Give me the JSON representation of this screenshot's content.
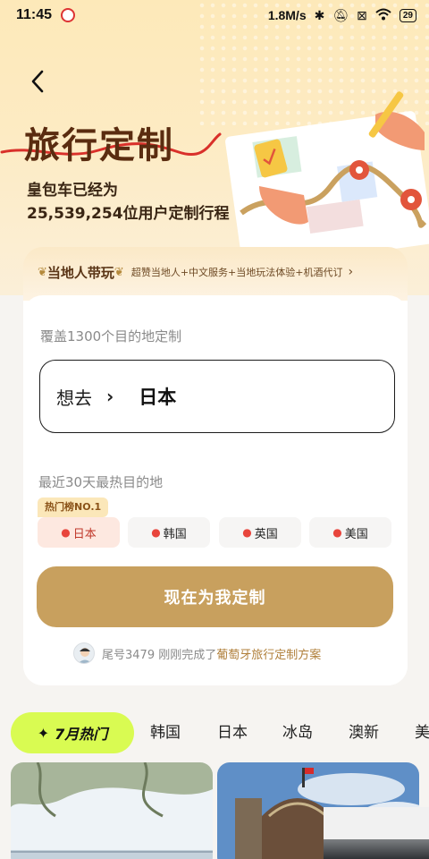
{
  "status_bar": {
    "time": "11:45",
    "network_speed": "1.8M/s",
    "battery": "29"
  },
  "header": {
    "title": "旅行定制",
    "subtitle_line1": "皇包车已经为",
    "subtitle_line2": "25,539,254位用户定制行程"
  },
  "local_guide": {
    "title": "当地人带玩",
    "description": "超赞当地人+中文服务+当地玩法体验+机酒代订"
  },
  "form": {
    "coverage_label": "覆盖1300个目的地定制",
    "destination_prefix": "想去",
    "destination_value": "日本",
    "hot_label": "最近30天最热目的地",
    "hot_badge": "热门榜NO.1",
    "destinations": [
      "日本",
      "韩国",
      "英国",
      "美国"
    ],
    "cta_label": "现在为我定制"
  },
  "activity": {
    "text": "尾号3479 刚刚完成了",
    "highlight": "葡萄牙旅行定制方案"
  },
  "tabs": {
    "active": "7月热门",
    "items": [
      "韩国",
      "日本",
      "冰岛",
      "澳新",
      "美"
    ]
  },
  "colors": {
    "accent_gold": "#c8a05e",
    "active_tab": "#d9fb52",
    "title_brown": "#5a2c10",
    "chip_active_bg": "#fde8e0"
  }
}
